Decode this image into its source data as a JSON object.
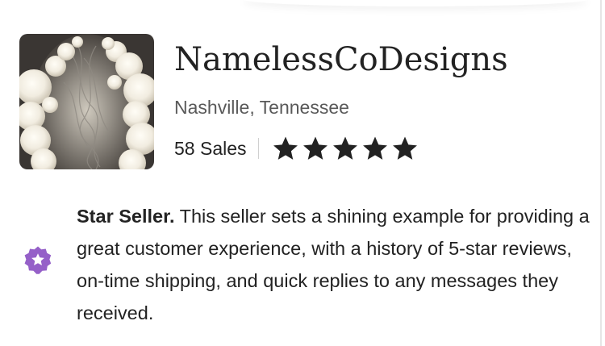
{
  "shop": {
    "name": "NamelessCoDesigns",
    "location": "Nashville, Tennessee",
    "sales_label": "58 Sales",
    "rating_stars": 5,
    "thumbnail_alt": "string lights"
  },
  "star_seller": {
    "title": "Star Seller.",
    "description": " This seller sets a shining example for providing a great customer experience, with a history of 5-star reviews, on-time shipping, and quick replies to any messages they received.",
    "icon": "star-badge-icon"
  },
  "colors": {
    "star": "#222222",
    "badge": "#9560c8",
    "muted_text": "#595959"
  }
}
